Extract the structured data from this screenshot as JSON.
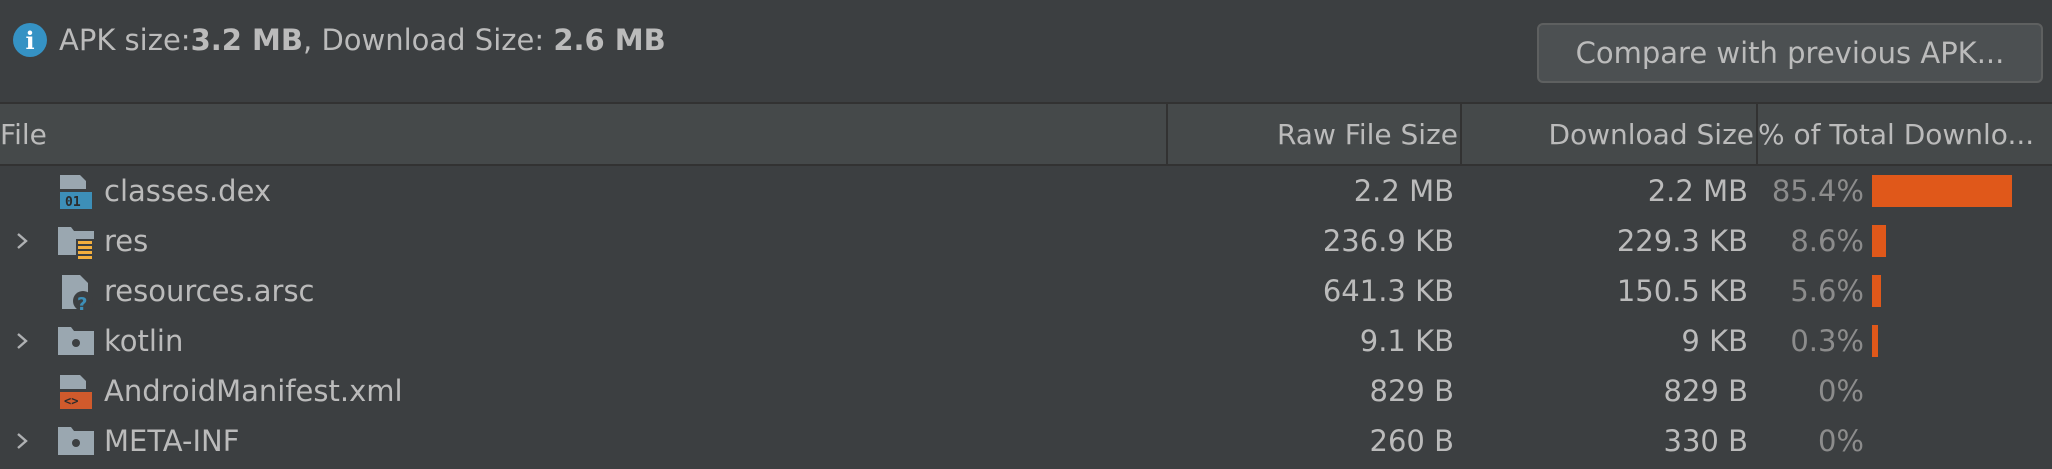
{
  "summary": {
    "apk_size_label": "APK size: ",
    "apk_size_value": "3.2 MB",
    "separator": ", ",
    "download_size_label": "Download Size: ",
    "download_size_value": "2.6 MB"
  },
  "actions": {
    "compare_label": "Compare with previous APK..."
  },
  "table": {
    "headers": {
      "file": "File",
      "raw": "Raw File Size",
      "download": "Download Size",
      "percent": "% of Total Downlo..."
    },
    "rows": [
      {
        "name": "classes.dex",
        "icon": "dex-file-icon",
        "expandable": false,
        "raw": "2.2 MB",
        "download": "2.2 MB",
        "percent": "85.4%",
        "fraction": 0.854
      },
      {
        "name": "res",
        "icon": "resource-folder-icon",
        "expandable": true,
        "raw": "236.9 KB",
        "download": "229.3 KB",
        "percent": "8.6%",
        "fraction": 0.086
      },
      {
        "name": "resources.arsc",
        "icon": "unknown-file-icon",
        "expandable": false,
        "raw": "641.3 KB",
        "download": "150.5 KB",
        "percent": "5.6%",
        "fraction": 0.056
      },
      {
        "name": "kotlin",
        "icon": "folder-icon",
        "expandable": true,
        "raw": "9.1 KB",
        "download": "9 KB",
        "percent": "0.3%",
        "fraction": 0.003
      },
      {
        "name": "AndroidManifest.xml",
        "icon": "xml-file-icon",
        "expandable": false,
        "raw": "829 B",
        "download": "829 B",
        "percent": "0%",
        "fraction": 0
      },
      {
        "name": "META-INF",
        "icon": "folder-icon",
        "expandable": true,
        "raw": "260 B",
        "download": "330 B",
        "percent": "0%",
        "fraction": 0
      }
    ]
  },
  "colors": {
    "background": "#3c3f41",
    "header_background": "#45494a",
    "bar": "#e0581a",
    "info_icon": "#3592c4",
    "text": "#bbbbbb",
    "muted_text": "#8c8c8c"
  }
}
